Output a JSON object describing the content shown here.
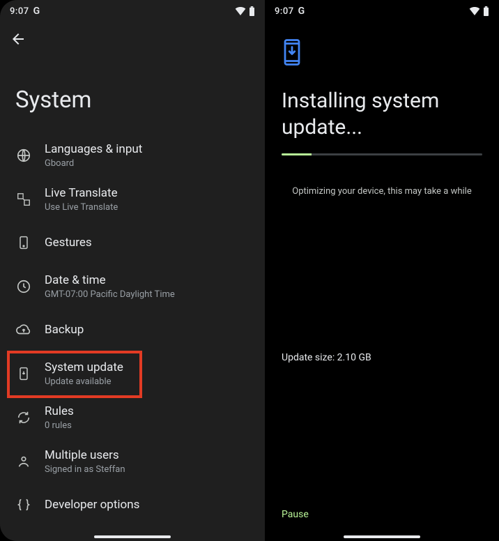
{
  "statusbar": {
    "time": "9:07",
    "brand": "G"
  },
  "left": {
    "title": "System",
    "items": [
      {
        "title": "Languages & input",
        "subtitle": "Gboard"
      },
      {
        "title": "Live Translate",
        "subtitle": "Use Live Translate"
      },
      {
        "title": "Gestures",
        "subtitle": ""
      },
      {
        "title": "Date & time",
        "subtitle": "GMT-07:00 Pacific Daylight Time"
      },
      {
        "title": "Backup",
        "subtitle": ""
      },
      {
        "title": "System update",
        "subtitle": "Update available"
      },
      {
        "title": "Rules",
        "subtitle": "0 rules"
      },
      {
        "title": "Multiple users",
        "subtitle": "Signed in as Steffan"
      },
      {
        "title": "Developer options",
        "subtitle": ""
      }
    ]
  },
  "right": {
    "title": "Installing system update...",
    "progress_percent": 15,
    "optimizing_text": "Optimizing your device, this may take a while",
    "update_size_label": "Update size: 2.10 GB",
    "pause_label": "Pause"
  },
  "colors": {
    "accent": "#b8f397",
    "highlight": "#e23b24",
    "update_icon": "#4285f4"
  }
}
